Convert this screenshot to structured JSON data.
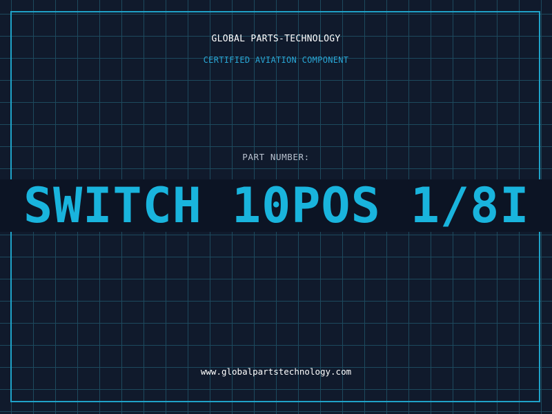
{
  "header": {
    "brand": "GLOBAL PARTS-TECHNOLOGY",
    "subtitle": "CERTIFIED AVIATION COMPONENT"
  },
  "part": {
    "label": "PART NUMBER:",
    "value": "SWITCH 10POS 1/8I"
  },
  "footer": {
    "url": "www.globalpartstechnology.com"
  },
  "colors": {
    "background": "#101a2c",
    "grid": "#1d4a5e",
    "accent": "#1fa3c9",
    "part_number": "#19b4dd"
  }
}
